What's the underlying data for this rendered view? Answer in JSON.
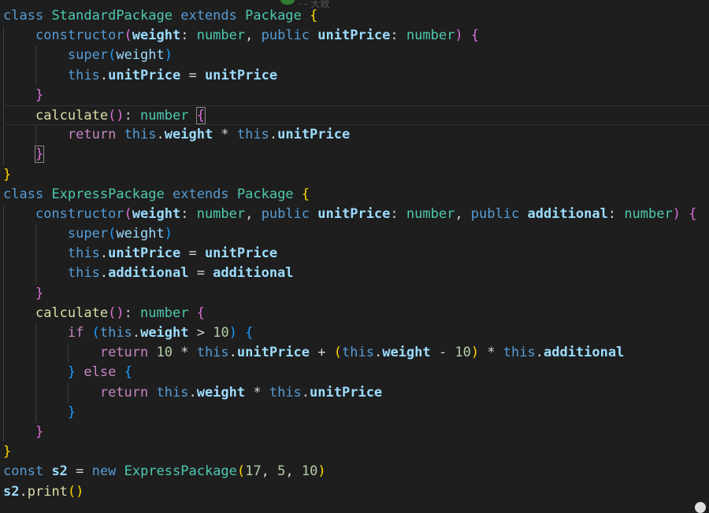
{
  "top_fragment": "- -  大致",
  "lines": [
    {
      "indent": 0,
      "tokens": [
        [
          "kw",
          "class"
        ],
        [
          "op",
          " "
        ],
        [
          "ty",
          "StandardPackage"
        ],
        [
          "op",
          " "
        ],
        [
          "kw",
          "extends"
        ],
        [
          "op",
          " "
        ],
        [
          "ty",
          "Package"
        ],
        [
          "op",
          " "
        ],
        [
          "b1",
          "{"
        ]
      ]
    },
    {
      "indent": 1,
      "tokens": [
        [
          "kw",
          "constructor"
        ],
        [
          "b2",
          "("
        ],
        [
          "vard",
          "weight"
        ],
        [
          "op",
          ": "
        ],
        [
          "ty",
          "number"
        ],
        [
          "op",
          ", "
        ],
        [
          "kw",
          "public"
        ],
        [
          "op",
          " "
        ],
        [
          "vard",
          "unitPrice"
        ],
        [
          "op",
          ": "
        ],
        [
          "ty",
          "number"
        ],
        [
          "b2",
          ")"
        ],
        [
          "op",
          " "
        ],
        [
          "b2",
          "{"
        ]
      ]
    },
    {
      "indent": 2,
      "tokens": [
        [
          "kw",
          "super"
        ],
        [
          "b3",
          "("
        ],
        [
          "var",
          "weight"
        ],
        [
          "b3",
          ")"
        ]
      ]
    },
    {
      "indent": 2,
      "tokens": [
        [
          "kw",
          "this"
        ],
        [
          "op",
          "."
        ],
        [
          "vard",
          "unitPrice"
        ],
        [
          "op",
          " = "
        ],
        [
          "vard",
          "unitPrice"
        ]
      ]
    },
    {
      "indent": 1,
      "tokens": [
        [
          "b2",
          "}"
        ]
      ]
    },
    {
      "indent": 1,
      "current": true,
      "tokens": [
        [
          "fn",
          "calculate"
        ],
        [
          "b2",
          "()"
        ],
        [
          "op",
          ": "
        ],
        [
          "ty",
          "number"
        ],
        [
          "op",
          " "
        ],
        [
          "b2m",
          "{"
        ]
      ]
    },
    {
      "indent": 2,
      "tokens": [
        [
          "ctl",
          "return"
        ],
        [
          "op",
          " "
        ],
        [
          "kw",
          "this"
        ],
        [
          "op",
          "."
        ],
        [
          "vard",
          "weight"
        ],
        [
          "op",
          " * "
        ],
        [
          "kw",
          "this"
        ],
        [
          "op",
          "."
        ],
        [
          "vard",
          "unitPrice"
        ]
      ]
    },
    {
      "indent": 1,
      "tokens": [
        [
          "b2m",
          "}"
        ]
      ]
    },
    {
      "indent": 0,
      "tokens": [
        [
          "b1",
          "}"
        ]
      ]
    },
    {
      "indent": 0,
      "tokens": [
        [
          "kw",
          "class"
        ],
        [
          "op",
          " "
        ],
        [
          "ty",
          "ExpressPackage"
        ],
        [
          "op",
          " "
        ],
        [
          "kw",
          "extends"
        ],
        [
          "op",
          " "
        ],
        [
          "ty",
          "Package"
        ],
        [
          "op",
          " "
        ],
        [
          "b1",
          "{"
        ]
      ]
    },
    {
      "indent": 1,
      "tokens": [
        [
          "kw",
          "constructor"
        ],
        [
          "b2",
          "("
        ],
        [
          "vard",
          "weight"
        ],
        [
          "op",
          ": "
        ],
        [
          "ty",
          "number"
        ],
        [
          "op",
          ", "
        ],
        [
          "kw",
          "public"
        ],
        [
          "op",
          " "
        ],
        [
          "vard",
          "unitPrice"
        ],
        [
          "op",
          ": "
        ],
        [
          "ty",
          "number"
        ],
        [
          "op",
          ", "
        ],
        [
          "kw",
          "public"
        ],
        [
          "op",
          " "
        ],
        [
          "vard",
          "additional"
        ],
        [
          "op",
          ": "
        ],
        [
          "ty",
          "number"
        ],
        [
          "b2",
          ")"
        ],
        [
          "op",
          " "
        ],
        [
          "b2",
          "{"
        ]
      ]
    },
    {
      "indent": 2,
      "tokens": [
        [
          "kw",
          "super"
        ],
        [
          "b3",
          "("
        ],
        [
          "var",
          "weight"
        ],
        [
          "b3",
          ")"
        ]
      ]
    },
    {
      "indent": 2,
      "tokens": [
        [
          "kw",
          "this"
        ],
        [
          "op",
          "."
        ],
        [
          "vard",
          "unitPrice"
        ],
        [
          "op",
          " = "
        ],
        [
          "vard",
          "unitPrice"
        ]
      ]
    },
    {
      "indent": 2,
      "tokens": [
        [
          "kw",
          "this"
        ],
        [
          "op",
          "."
        ],
        [
          "vard",
          "additional"
        ],
        [
          "op",
          " = "
        ],
        [
          "vard",
          "additional"
        ]
      ]
    },
    {
      "indent": 1,
      "tokens": [
        [
          "b2",
          "}"
        ]
      ]
    },
    {
      "indent": 1,
      "tokens": [
        [
          "fn",
          "calculate"
        ],
        [
          "b2",
          "()"
        ],
        [
          "op",
          ": "
        ],
        [
          "ty",
          "number"
        ],
        [
          "op",
          " "
        ],
        [
          "b2",
          "{"
        ]
      ]
    },
    {
      "indent": 2,
      "tokens": [
        [
          "ctl",
          "if"
        ],
        [
          "op",
          " "
        ],
        [
          "b3",
          "("
        ],
        [
          "kw",
          "this"
        ],
        [
          "op",
          "."
        ],
        [
          "vard",
          "weight"
        ],
        [
          "op",
          " > "
        ],
        [
          "num",
          "10"
        ],
        [
          "b3",
          ")"
        ],
        [
          "op",
          " "
        ],
        [
          "b3",
          "{"
        ]
      ]
    },
    {
      "indent": 3,
      "tokens": [
        [
          "ctl",
          "return"
        ],
        [
          "op",
          " "
        ],
        [
          "num",
          "10"
        ],
        [
          "op",
          " * "
        ],
        [
          "kw",
          "this"
        ],
        [
          "op",
          "."
        ],
        [
          "vard",
          "unitPrice"
        ],
        [
          "op",
          " + "
        ],
        [
          "b1",
          "("
        ],
        [
          "kw",
          "this"
        ],
        [
          "op",
          "."
        ],
        [
          "vard",
          "weight"
        ],
        [
          "op",
          " - "
        ],
        [
          "num",
          "10"
        ],
        [
          "b1",
          ")"
        ],
        [
          "op",
          " * "
        ],
        [
          "kw",
          "this"
        ],
        [
          "op",
          "."
        ],
        [
          "vard",
          "additional"
        ]
      ]
    },
    {
      "indent": 2,
      "tokens": [
        [
          "b3",
          "}"
        ],
        [
          "op",
          " "
        ],
        [
          "ctl",
          "else"
        ],
        [
          "op",
          " "
        ],
        [
          "b3",
          "{"
        ]
      ]
    },
    {
      "indent": 3,
      "tokens": [
        [
          "ctl",
          "return"
        ],
        [
          "op",
          " "
        ],
        [
          "kw",
          "this"
        ],
        [
          "op",
          "."
        ],
        [
          "vard",
          "weight"
        ],
        [
          "op",
          " * "
        ],
        [
          "kw",
          "this"
        ],
        [
          "op",
          "."
        ],
        [
          "vard",
          "unitPrice"
        ]
      ]
    },
    {
      "indent": 2,
      "tokens": [
        [
          "b3",
          "}"
        ]
      ]
    },
    {
      "indent": 1,
      "tokens": [
        [
          "b2",
          "}"
        ]
      ]
    },
    {
      "indent": 0,
      "tokens": [
        [
          "b1",
          "}"
        ]
      ]
    },
    {
      "indent": 0,
      "tokens": [
        [
          "kw",
          "const"
        ],
        [
          "op",
          " "
        ],
        [
          "vard",
          "s2"
        ],
        [
          "op",
          " = "
        ],
        [
          "kw",
          "new"
        ],
        [
          "op",
          " "
        ],
        [
          "ty",
          "ExpressPackage"
        ],
        [
          "b1",
          "("
        ],
        [
          "num",
          "17"
        ],
        [
          "op",
          ", "
        ],
        [
          "num",
          "5"
        ],
        [
          "op",
          ", "
        ],
        [
          "num",
          "10"
        ],
        [
          "b1",
          ")"
        ]
      ]
    },
    {
      "indent": 0,
      "tokens": [
        [
          "vard",
          "s2"
        ],
        [
          "op",
          "."
        ],
        [
          "fn",
          "print"
        ],
        [
          "b1",
          "()"
        ]
      ]
    }
  ]
}
